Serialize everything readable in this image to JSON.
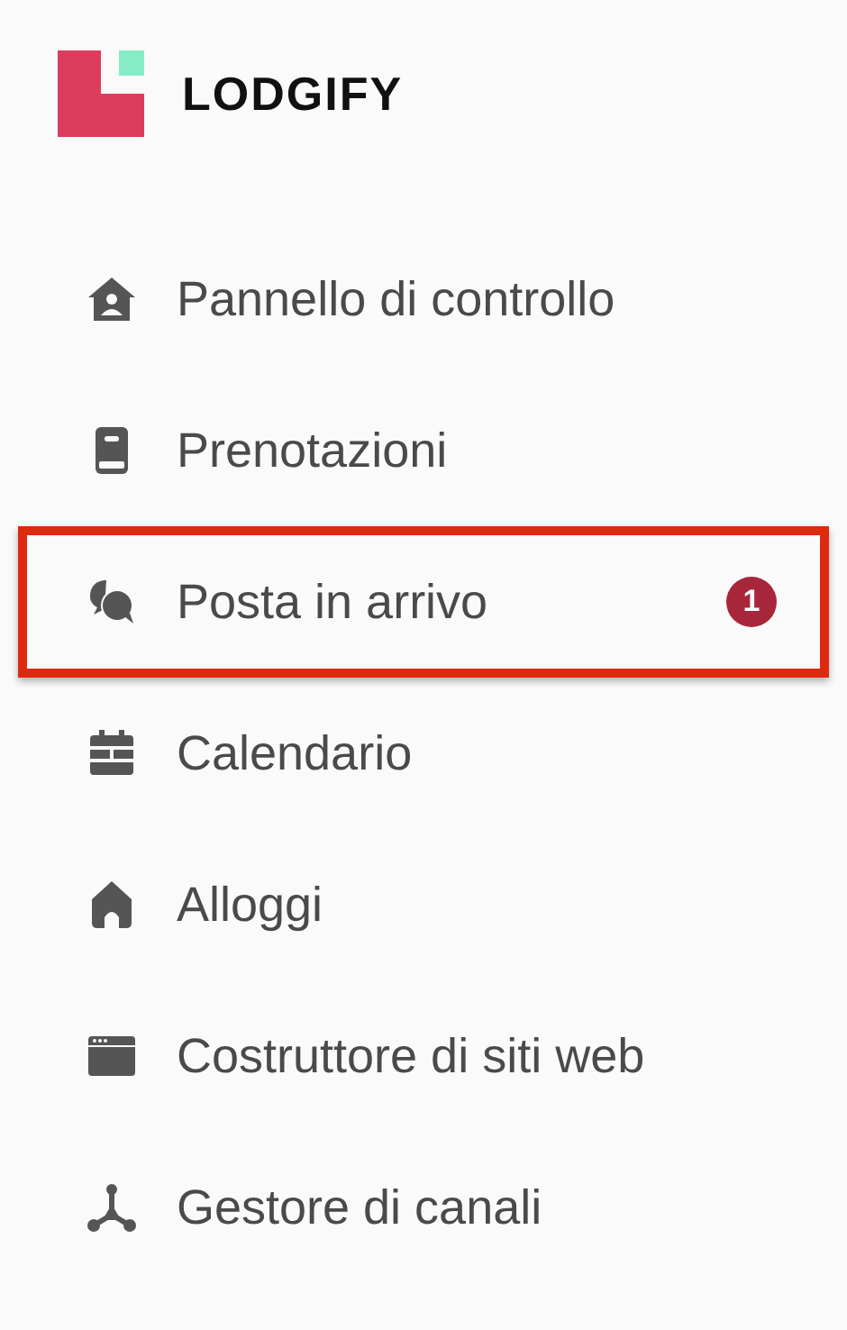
{
  "logo": {
    "text": "LODGIFY"
  },
  "menu": [
    {
      "label": "Pannello di controllo",
      "kind": "dashboard",
      "highlighted": false
    },
    {
      "label": "Prenotazioni",
      "kind": "bookings",
      "highlighted": false
    },
    {
      "label": "Posta in arrivo",
      "kind": "inbox",
      "highlighted": true,
      "badge": "1"
    },
    {
      "label": "Calendario",
      "kind": "calendar",
      "highlighted": false
    },
    {
      "label": "Alloggi",
      "kind": "rentals",
      "highlighted": false
    },
    {
      "label": "Costruttore di siti web",
      "kind": "website",
      "highlighted": false
    },
    {
      "label": "Gestore di canali",
      "kind": "channels",
      "highlighted": false
    }
  ]
}
